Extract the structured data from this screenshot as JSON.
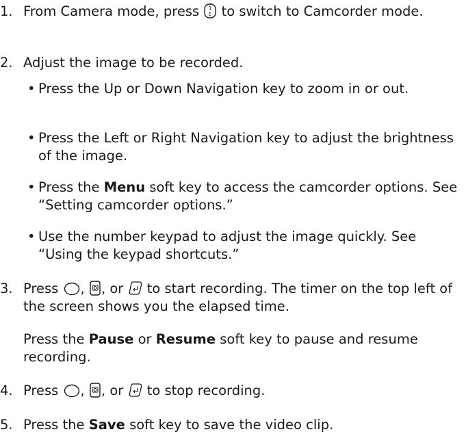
{
  "steps": [
    {
      "number": "1.",
      "parts": [
        "From Camera mode, press",
        "to switch to Camcorder mode."
      ]
    },
    {
      "number": "2.",
      "text": "Adjust the image to be recorded.",
      "bullets": [
        {
          "text": "Press the Up or Down Navigation key to zoom in or out."
        },
        {
          "text": "Press the Left or Right Navigation key to adjust the brightness of the image."
        },
        {
          "pre": "Press the",
          "bold": "Menu",
          "post": "soft key to access the camcorder options. See “Setting camcorder options.”"
        },
        {
          "text": "Use the number keypad to adjust the image quickly. See “Using the keypad shortcuts.”"
        }
      ]
    },
    {
      "number": "3.",
      "parts": [
        "Press",
        ",",
        ", or",
        "to start recording. The timer on the top left of the screen shows you the elapsed time."
      ],
      "note": {
        "pre": "Press the",
        "bold1": "Pause",
        "mid": "or",
        "bold2": "Resume",
        "post": "soft key to pause and resume recording."
      }
    },
    {
      "number": "4.",
      "parts": [
        "Press",
        ",",
        ", or",
        "to stop recording."
      ]
    },
    {
      "number": "5.",
      "pre": "Press the",
      "bold": "Save",
      "post": "soft key to save the video clip."
    }
  ],
  "icons": {
    "key_1": "key-1-icon",
    "ok": "ok-key-icon",
    "camera": "camera-key-icon",
    "enter": "enter-key-icon"
  }
}
